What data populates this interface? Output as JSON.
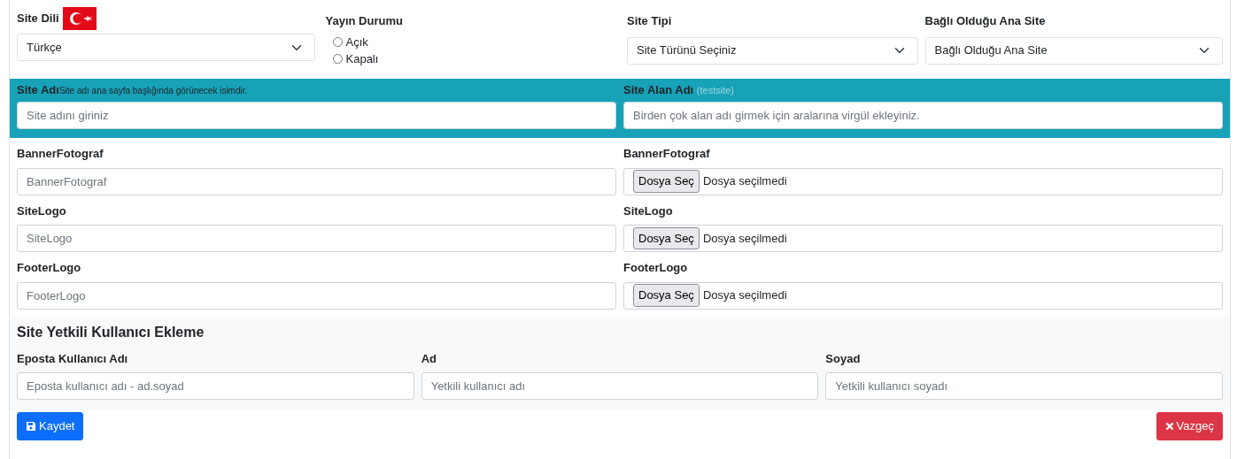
{
  "language": {
    "label": "Site Dili",
    "value": "Türkçe"
  },
  "publish_status": {
    "label": "Yayın Durumu",
    "options": [
      {
        "label": "Açık",
        "selected": false
      },
      {
        "label": "Kapalı",
        "selected": false
      }
    ]
  },
  "site_type": {
    "label": "Site Tipi",
    "value": "Site Türünü Seçiniz"
  },
  "parent_site": {
    "label": "Bağlı Olduğu Ana Site",
    "value": "Bağlı Olduğu Ana Site"
  },
  "site_name": {
    "label": "Site Adı",
    "hint": "Site adı ana sayfa başlığında görünecek isimdir.",
    "placeholder": "Site adını giriniz"
  },
  "domain": {
    "label": "Site Alan Adı",
    "hint": "(testsite)",
    "placeholder": "Birden çok alan adı girmek için aralarına virgül ekleyiniz."
  },
  "image_fields": [
    {
      "label": "BannerFotograf",
      "placeholder": "BannerFotograf",
      "file_label": "BannerFotograf",
      "file_button": "Dosya Seç",
      "file_status": "Dosya seçilmedi"
    },
    {
      "label": "SiteLogo",
      "placeholder": "SiteLogo",
      "file_label": "SiteLogo",
      "file_button": "Dosya Seç",
      "file_status": "Dosya seçilmedi"
    },
    {
      "label": "FooterLogo",
      "placeholder": "FooterLogo",
      "file_label": "FooterLogo",
      "file_button": "Dosya Seç",
      "file_status": "Dosya seçilmedi"
    }
  ],
  "admin": {
    "title": "Site Yetkili Kullanıcı Ekleme",
    "fields": [
      {
        "label": "Eposta Kullanıcı Adı",
        "placeholder": "Eposta kullanıcı adı - ad.soyad"
      },
      {
        "label": "Ad",
        "placeholder": "Yetkili kullanıcı adı"
      },
      {
        "label": "Soyad",
        "placeholder": "Yetkili kullanıcı soyadı"
      }
    ]
  },
  "buttons": {
    "save": "Kaydet",
    "cancel": "Vazgeç"
  }
}
